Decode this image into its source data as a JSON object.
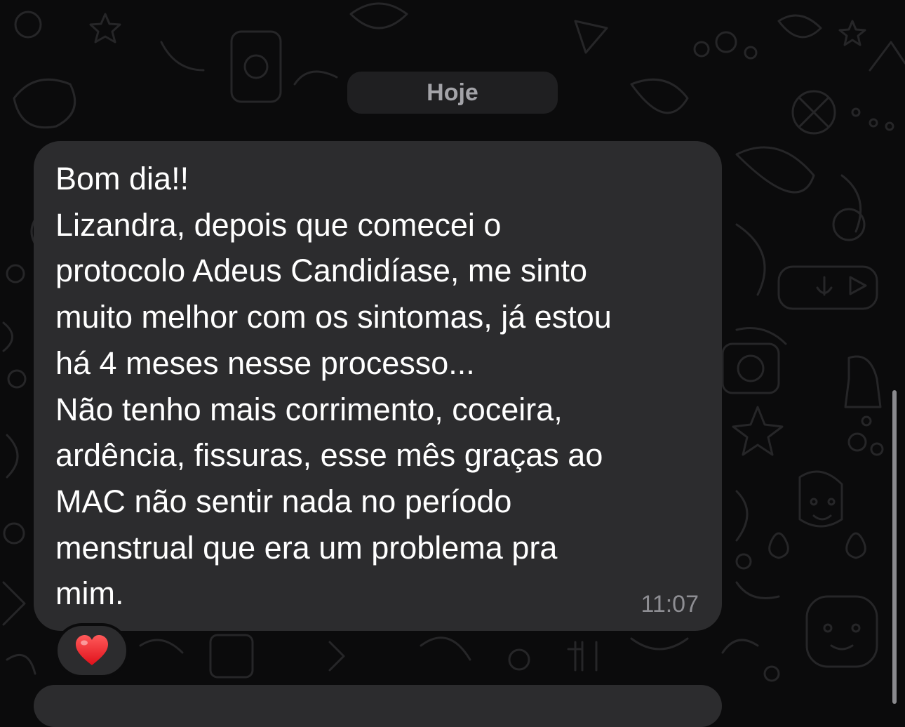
{
  "chat": {
    "date_separator": "Hoje",
    "message": {
      "text": "Bom dia!!\nLizandra, depois que comecei o\nprotocolo Adeus Candidíase, me sinto\nmuito melhor com os sintomas, já estou\nhá 4 meses nesse processo...\nNão tenho mais corrimento, coceira,\nardência, fissuras, esse mês graças ao\nMAC não sentir nada no período\nmenstrual que era um problema pra\nmim.",
      "time": "11:07",
      "reaction": {
        "icon": "heart-icon",
        "color": "#ff2d2d"
      }
    }
  },
  "colors": {
    "background": "#0b0b0c",
    "bubble": "#2c2c2e",
    "text": "#ffffff",
    "secondary_text": "#8e8e93"
  }
}
